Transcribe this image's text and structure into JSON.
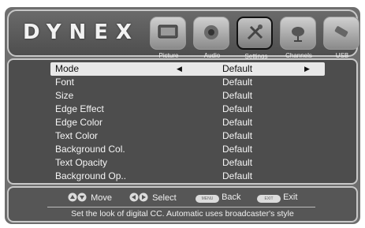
{
  "brand": "DYNEX",
  "tabs": [
    {
      "label": "Picture",
      "icon": "picture-icon",
      "selected": false
    },
    {
      "label": "Audio",
      "icon": "audio-icon",
      "selected": false
    },
    {
      "label": "Settings",
      "icon": "settings-icon",
      "selected": true
    },
    {
      "label": "Channels",
      "icon": "channels-icon",
      "selected": false
    },
    {
      "label": "USB",
      "icon": "usb-icon",
      "selected": false
    }
  ],
  "menu": {
    "rows": [
      {
        "label": "Mode",
        "value": "Default"
      },
      {
        "label": "Font",
        "value": "Default"
      },
      {
        "label": "Size",
        "value": "Default"
      },
      {
        "label": "Edge Effect",
        "value": "Default"
      },
      {
        "label": "Edge Color",
        "value": "Default"
      },
      {
        "label": "Text Color",
        "value": "Default"
      },
      {
        "label": "Background Col.",
        "value": "Default"
      },
      {
        "label": "Text Opacity",
        "value": "Default"
      },
      {
        "label": "Background Op..",
        "value": "Default"
      }
    ],
    "arrows": {
      "left": "◀",
      "right": "▶"
    }
  },
  "footer": {
    "move": "Move",
    "select": "Select",
    "back": "Back",
    "exit": "Exit",
    "menu_key": "MENU",
    "exit_key": "EXIT",
    "help": "Set the look of digital CC. Automatic uses broadcaster's style"
  }
}
